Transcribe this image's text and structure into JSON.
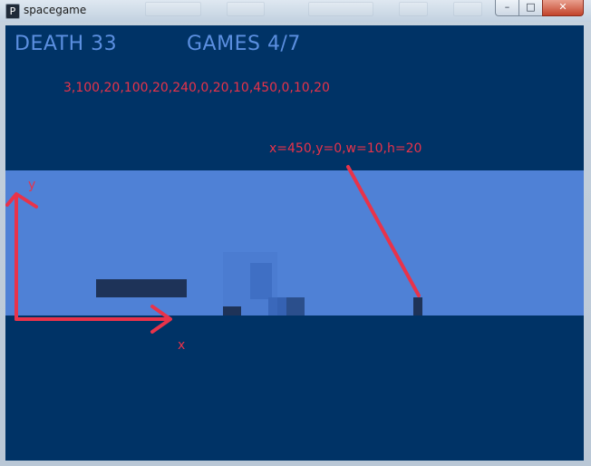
{
  "window": {
    "title": "spacegame",
    "app_icon": "P",
    "controls": {
      "minimize": "–",
      "maximize": "□",
      "close": "✕"
    }
  },
  "hud": {
    "death": "DEATH 33",
    "games": "GAMES 4/7"
  },
  "annotations": {
    "level_data": "3,100,20,100,20,240,0,20,10,450,0,10,20",
    "obstacle_label": "x=450,y=0,w=10,h=20",
    "y_axis_label": "y",
    "x_axis_label": "x",
    "color": "#e8334a"
  },
  "colors": {
    "canvas_bg": "#003366",
    "sky": "#4f81d6",
    "hud_text": "#5b8fe0",
    "obstacle": "#1e3358"
  }
}
